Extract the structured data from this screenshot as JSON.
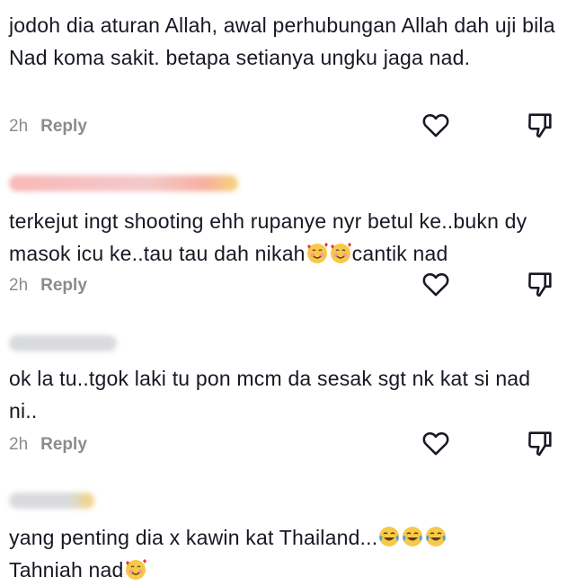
{
  "comments": [
    {
      "text": "jodoh dia aturan Allah, awal perhubungan Allah dah uji bila Nad koma sakit. betapa setianya ungku jaga nad.",
      "time": "2h",
      "reply_label": "Reply"
    },
    {
      "text_parts": [
        "terkejut ingt shooting ehh rupanye nyr betul ke..bukn dy masok icu ke..tau tau dah nikah",
        "cantik nad"
      ],
      "emojis": [
        "smiling-face-with-hearts",
        "smiling-face-with-hearts"
      ],
      "time": "2h",
      "reply_label": "Reply"
    },
    {
      "text": "ok la tu..tgok laki tu pon mcm da sesak sgt nk kat si nad ni..",
      "time": "2h",
      "reply_label": "Reply"
    },
    {
      "text_parts": [
        "yang penting dia x kawin kat Thailand...",
        "Tahniah nad"
      ],
      "emojis": [
        "tears-of-joy",
        "tears-of-joy",
        "tears-of-joy",
        "smiling-face-with-hearts"
      ]
    }
  ],
  "colors": {
    "text": "#161823",
    "meta": "#8a8b91",
    "icon": "#161823"
  }
}
